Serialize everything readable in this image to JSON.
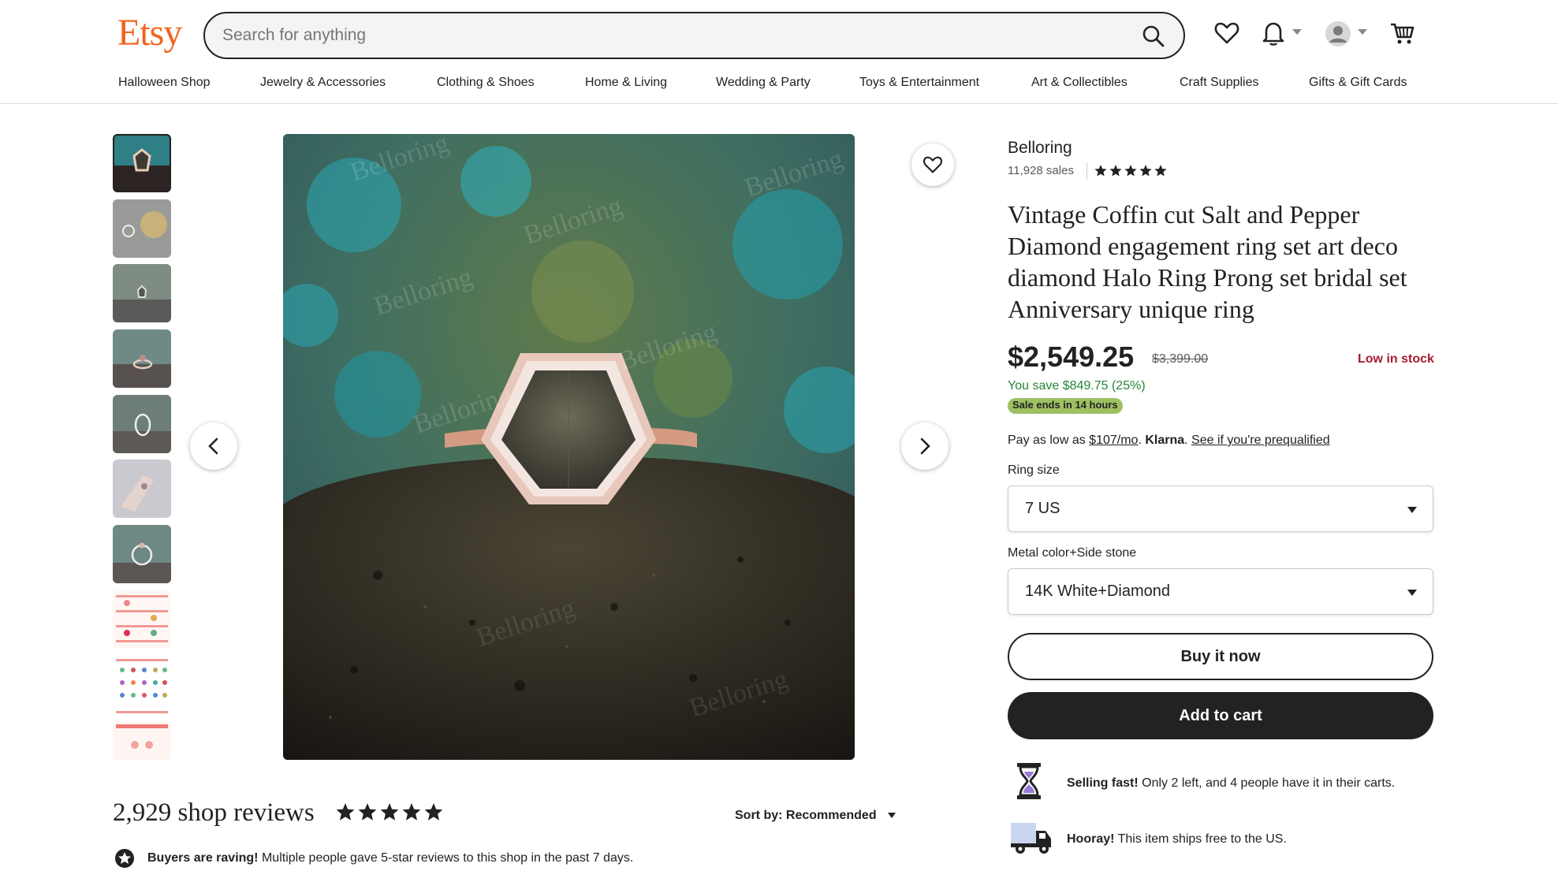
{
  "header": {
    "logo": "Etsy",
    "search_placeholder": "Search for anything"
  },
  "categories": [
    "Halloween Shop",
    "Jewelry & Accessories",
    "Clothing & Shoes",
    "Home & Living",
    "Wedding & Party",
    "Toys & Entertainment",
    "Art & Collectibles",
    "Craft Supplies",
    "Gifts & Gift Cards"
  ],
  "gallery": {
    "thumbnail_count": 10,
    "active_index": 0,
    "watermark": "Belloring"
  },
  "listing": {
    "shop_name": "Belloring",
    "sales": "11,928 sales",
    "rating_stars": 5,
    "title": "Vintage Coffin cut Salt and Pepper Diamond engagement ring set art deco diamond Halo Ring Prong set bridal set Anniversary unique ring",
    "price": "$2,549.25",
    "original_price": "$3,399.00",
    "stock_status": "Low in stock",
    "savings": "You save $849.75 (25%)",
    "sale_badge": "Sale ends in 14 hours",
    "klarna": {
      "prefix": "Pay as low as",
      "amount": "$107/mo",
      "period": ".",
      "brand": "Klarna",
      "link": "See if you're prequalified"
    },
    "ring_size_label": "Ring size",
    "ring_size_value": "7 US",
    "metal_label": "Metal color+Side stone",
    "metal_value": "14K White+Diamond",
    "buy_now": "Buy it now",
    "add_to_cart": "Add to cart",
    "selling_fast_bold": "Selling fast!",
    "selling_fast_text": "Only 2 left, and 4 people have it in their carts.",
    "shipping_bold": "Hooray!",
    "shipping_text": "This item ships free to the US."
  },
  "reviews": {
    "title": "2,929 shop reviews",
    "stars": 5,
    "sort_label": "Sort by: Recommended",
    "raving_bold": "Buyers are raving!",
    "raving_text": "Multiple people gave 5-star reviews to this shop in the past 7 days."
  },
  "colors": {
    "brand": "#f1641e",
    "sale_green": "#258635",
    "badge_green": "#9ec063",
    "low_stock_red": "#a61a2e"
  }
}
